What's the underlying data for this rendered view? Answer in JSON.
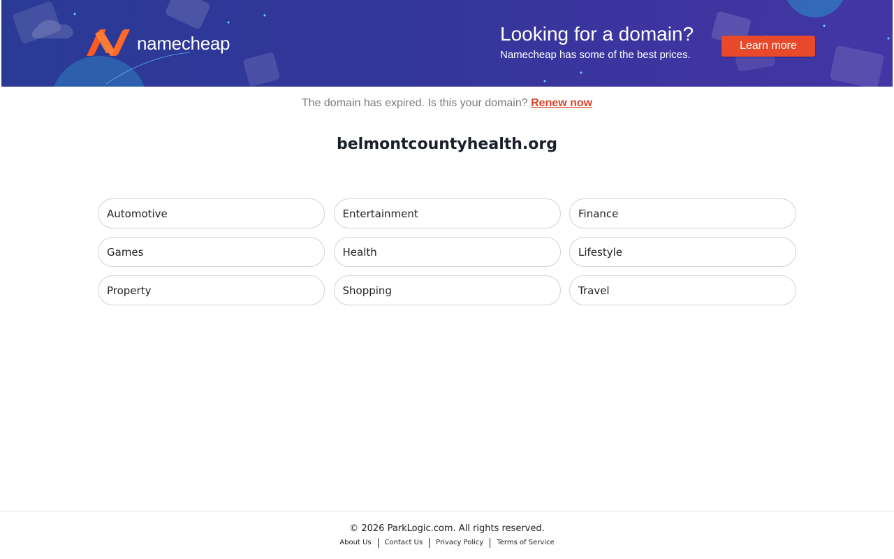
{
  "banner": {
    "brand_name": "namecheap",
    "headline": "Looking for a domain?",
    "subline": "Namecheap has some of the best prices.",
    "cta_label": "Learn more",
    "colors": {
      "accent": "#e8492b",
      "banner_bg": "#33369a",
      "logo_orange": "#ff6a2b"
    }
  },
  "notice": {
    "text": "The domain has expired. Is this your domain?",
    "renew_label": "Renew now"
  },
  "domain": "belmontcountyhealth.org",
  "categories": [
    "Automotive",
    "Entertainment",
    "Finance",
    "Games",
    "Health",
    "Lifestyle",
    "Property",
    "Shopping",
    "Travel"
  ],
  "footer": {
    "copyright": "© 2026 ParkLogic.com. All rights reserved.",
    "links": [
      "About Us",
      "Contact Us",
      "Privacy Policy",
      "Terms of Service"
    ]
  }
}
